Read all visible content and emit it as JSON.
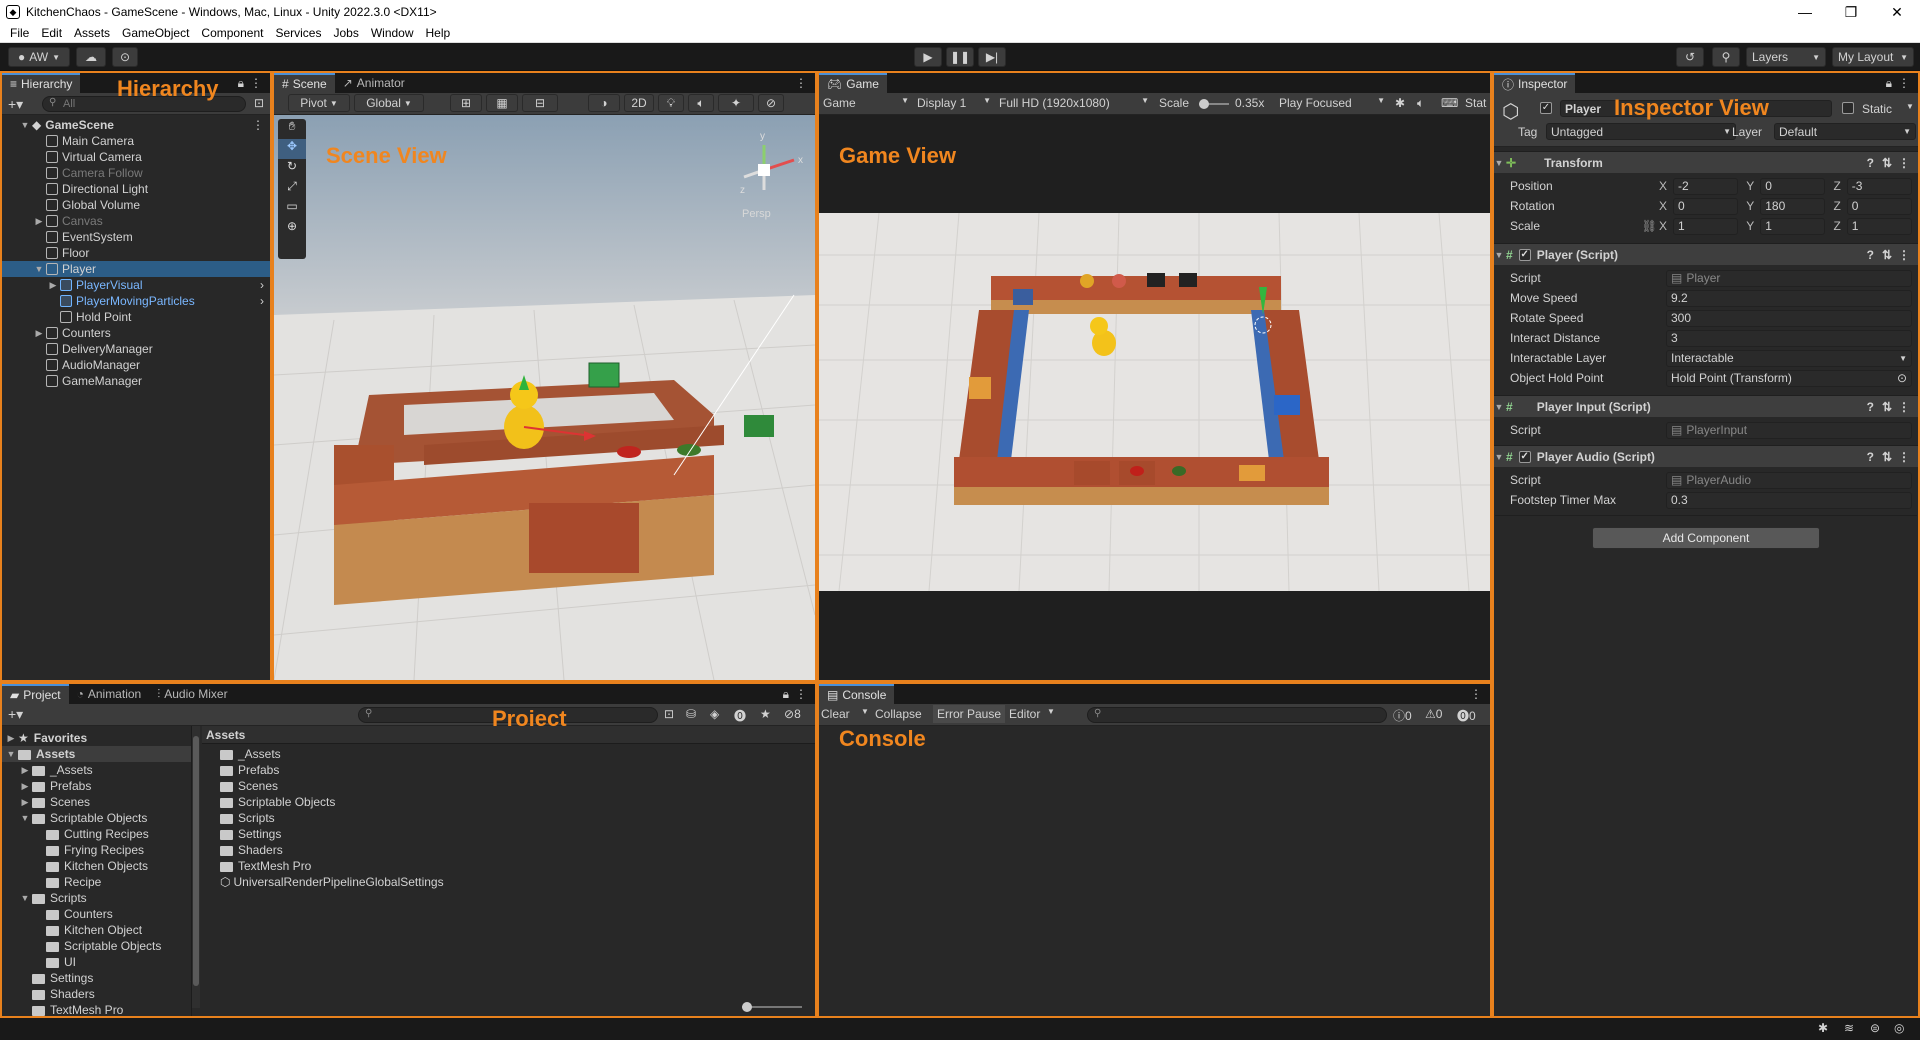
{
  "window": {
    "title": "KitchenChaos - GameScene - Windows, Mac, Linux - Unity 2022.3.0 <DX11>",
    "minimize": "—",
    "maximize": "❐",
    "close": "✕"
  },
  "menu": [
    "File",
    "Edit",
    "Assets",
    "GameObject",
    "Component",
    "Services",
    "Jobs",
    "Window",
    "Help"
  ],
  "toolbar": {
    "account": "AW",
    "layers": "Layers",
    "layout": "My Layout"
  },
  "hierarchy": {
    "tab": "Hierarchy",
    "search_placeholder": "All",
    "overlay_label": "Hierarchy",
    "scene": "GameScene",
    "items": [
      {
        "label": "Main Camera",
        "indent": 2,
        "style": "normal"
      },
      {
        "label": "Virtual Camera",
        "indent": 2,
        "style": "normal"
      },
      {
        "label": "Camera Follow",
        "indent": 2,
        "style": "dim"
      },
      {
        "label": "Directional Light",
        "indent": 2,
        "style": "normal"
      },
      {
        "label": "Global Volume",
        "indent": 2,
        "style": "normal"
      },
      {
        "label": "Canvas",
        "indent": 2,
        "style": "dim",
        "arrow": "▶"
      },
      {
        "label": "EventSystem",
        "indent": 2,
        "style": "normal"
      },
      {
        "label": "Floor",
        "indent": 2,
        "style": "normal"
      },
      {
        "label": "Player",
        "indent": 2,
        "style": "selected",
        "arrow": "▼"
      },
      {
        "label": "PlayerVisual",
        "indent": 3,
        "style": "prefab",
        "arrow": "▶"
      },
      {
        "label": "PlayerMovingParticles",
        "indent": 3,
        "style": "prefab"
      },
      {
        "label": "Hold Point",
        "indent": 3,
        "style": "normal"
      },
      {
        "label": "Counters",
        "indent": 2,
        "style": "normal",
        "arrow": "▶"
      },
      {
        "label": "DeliveryManager",
        "indent": 2,
        "style": "normal"
      },
      {
        "label": "AudioManager",
        "indent": 2,
        "style": "normal"
      },
      {
        "label": "GameManager",
        "indent": 2,
        "style": "normal"
      }
    ]
  },
  "scene": {
    "tabs": [
      "Scene",
      "Animator"
    ],
    "pivot": "Pivot",
    "global": "Global",
    "mode2d": "2D",
    "overlay_label": "Scene View",
    "persp": "Persp",
    "gizmo_y": "y",
    "gizmo_x": "x",
    "gizmo_z": "z"
  },
  "game": {
    "tab": "Game",
    "mode": "Game",
    "display": "Display 1",
    "resolution": "Full HD (1920x1080)",
    "scale_label": "Scale",
    "scale_value": "0.35x",
    "play_focused": "Play Focused",
    "stats": "Stat",
    "overlay_label": "Game View"
  },
  "inspector": {
    "tab": "Inspector",
    "overlay_label": "Inspector View",
    "object_name": "Player",
    "static_label": "Static",
    "tag_label": "Tag",
    "tag_value": "Untagged",
    "layer_label": "Layer",
    "layer_value": "Default",
    "transform": {
      "title": "Transform",
      "position_label": "Position",
      "position": {
        "x": "-2",
        "y": "0",
        "z": "-3"
      },
      "rotation_label": "Rotation",
      "rotation": {
        "x": "0",
        "y": "180",
        "z": "0"
      },
      "scale_label": "Scale",
      "scale": {
        "x": "1",
        "y": "1",
        "z": "1"
      }
    },
    "player_script": {
      "title": "Player (Script)",
      "script_label": "Script",
      "script_value": "Player",
      "props": [
        {
          "label": "Move Speed",
          "value": "9.2"
        },
        {
          "label": "Rotate Speed",
          "value": "300"
        },
        {
          "label": "Interact Distance",
          "value": "3"
        },
        {
          "label": "Interactable Layer",
          "value": "Interactable"
        },
        {
          "label": "Object Hold Point",
          "value": "Hold Point (Transform)"
        }
      ]
    },
    "player_input": {
      "title": "Player Input (Script)",
      "script_label": "Script",
      "script_value": "PlayerInput"
    },
    "player_audio": {
      "title": "Player Audio (Script)",
      "script_label": "Script",
      "script_value": "PlayerAudio",
      "footstep_label": "Footstep Timer Max",
      "footstep_value": "0.3"
    },
    "add_component": "Add Component"
  },
  "project": {
    "tabs": [
      "Project",
      "Animation",
      "Audio Mixer"
    ],
    "overlay_label": "Project",
    "hidden_count": "8",
    "tree": [
      {
        "label": "Favorites",
        "indent": 0,
        "arrow": "▶",
        "bold": true,
        "star": true
      },
      {
        "label": "Assets",
        "indent": 0,
        "arrow": "▼",
        "bold": true,
        "selected": true
      },
      {
        "label": "_Assets",
        "indent": 1,
        "arrow": "▶"
      },
      {
        "label": "Prefabs",
        "indent": 1,
        "arrow": "▶"
      },
      {
        "label": "Scenes",
        "indent": 1,
        "arrow": "▶"
      },
      {
        "label": "Scriptable Objects",
        "indent": 1,
        "arrow": "▼"
      },
      {
        "label": "Cutting Recipes",
        "indent": 2
      },
      {
        "label": "Frying Recipes",
        "indent": 2
      },
      {
        "label": "Kitchen Objects",
        "indent": 2
      },
      {
        "label": "Recipe",
        "indent": 2
      },
      {
        "label": "Scripts",
        "indent": 1,
        "arrow": "▼"
      },
      {
        "label": "Counters",
        "indent": 2
      },
      {
        "label": "Kitchen Object",
        "indent": 2
      },
      {
        "label": "Scriptable Objects",
        "indent": 2
      },
      {
        "label": "UI",
        "indent": 2
      },
      {
        "label": "Settings",
        "indent": 1
      },
      {
        "label": "Shaders",
        "indent": 1
      },
      {
        "label": "TextMesh Pro",
        "indent": 1
      }
    ],
    "assets_header": "Assets",
    "assets": [
      "_Assets",
      "Prefabs",
      "Scenes",
      "Scriptable Objects",
      "Scripts",
      "Settings",
      "Shaders",
      "TextMesh Pro",
      "UniversalRenderPipelineGlobalSettings"
    ]
  },
  "console": {
    "tab": "Console",
    "clear": "Clear",
    "collapse": "Collapse",
    "error_pause": "Error Pause",
    "editor": "Editor",
    "overlay_label": "Console",
    "count_log": "0",
    "count_warn": "0",
    "count_err": "0"
  },
  "colors": {
    "panel_highlight": "#e8811d",
    "selection": "#2c5d87",
    "prefab_blue": "#7ab7ff"
  }
}
